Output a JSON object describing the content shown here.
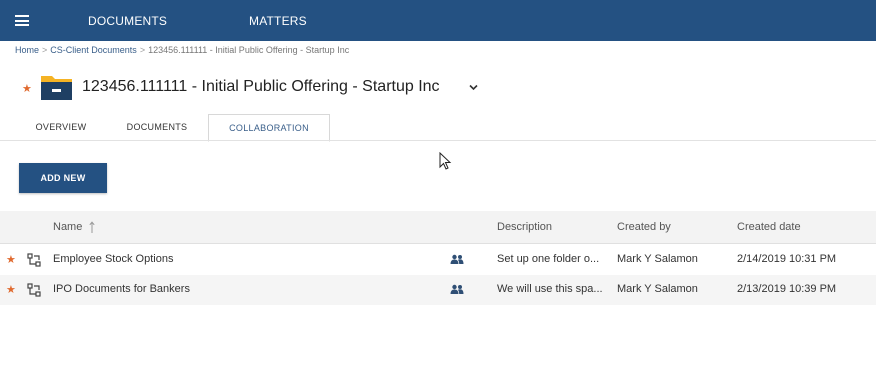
{
  "nav": {
    "documents": "DOCUMENTS",
    "matters": "MATTERS"
  },
  "breadcrumb": {
    "home": "Home",
    "sep1": ">",
    "client": "CS-Client Documents",
    "sep2": ">",
    "current": "123456.111111 - Initial Public Offering - Startup Inc"
  },
  "matter": {
    "title": "123456.111111 - Initial Public Offering - Startup Inc",
    "favorite_icon": "star-icon",
    "folder_icon": "folder-icon"
  },
  "tabs": [
    {
      "label": "OVERVIEW",
      "active": false
    },
    {
      "label": "DOCUMENTS",
      "active": false
    },
    {
      "label": "COLLABORATION",
      "active": true
    }
  ],
  "add_new": "ADD NEW",
  "table": {
    "headers": {
      "name": "Name",
      "description": "Description",
      "created_by": "Created by",
      "created_date": "Created date"
    },
    "sort": {
      "column": "name",
      "direction": "ascending"
    },
    "rows": [
      {
        "name": "Employee Stock Options",
        "description": "Set up one folder o...",
        "created_by": "Mark Y Salamon",
        "created_date": "2/14/2019 10:31 PM"
      },
      {
        "name": "IPO Documents for Bankers",
        "description": "We will use this spa...",
        "created_by": "Mark Y Salamon",
        "created_date": "2/13/2019 10:39 PM"
      }
    ]
  },
  "colors": {
    "header_bg": "#245182",
    "accent_star": "#e06a2f",
    "folder": "#f5b324"
  }
}
